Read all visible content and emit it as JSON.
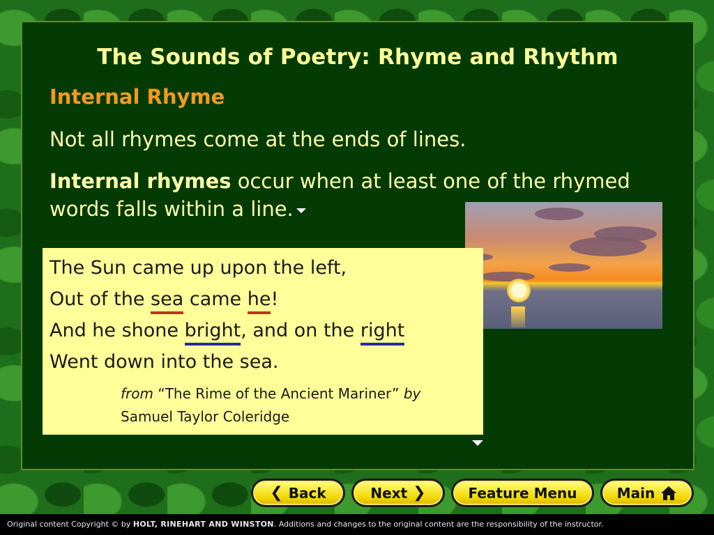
{
  "slide": {
    "title": "The Sounds of Poetry: Rhyme and Rhythm",
    "subtitle": "Internal Rhyme",
    "line1": "Not all rhymes come at the ends of lines.",
    "definition_term": "Internal rhymes",
    "definition_rest": " occur when at least one of the rhymed words falls within a line."
  },
  "poem": {
    "line1": "The Sun came up upon the left,",
    "line2_a": "Out of the ",
    "line2_b": "sea",
    "line2_c": " came ",
    "line2_d": "he",
    "line2_e": "!",
    "line3_a": "And he shone ",
    "line3_b": "bright",
    "line3_c": ", and on the ",
    "line3_d": "right",
    "line4": "Went down into the sea.",
    "cite_from": "from",
    "cite_title": " “The Rime of the Ancient Mariner” ",
    "cite_by": "by",
    "cite_author": "Samuel Taylor Coleridge"
  },
  "nav": {
    "back": "Back",
    "next": "Next",
    "feature_menu": "Feature Menu",
    "main": "Main"
  },
  "footer": {
    "prefix": "Original content Copyright © by ",
    "publisher": "HOLT, RINEHART AND WINSTON",
    "suffix": ". Additions and changes to the original content are the responsibility of the instructor."
  },
  "colors": {
    "slide_bg": "#043b05",
    "title": "#ffff99",
    "subtitle": "#f39a1f",
    "poem_bg": "#ffff99",
    "underline_red": "#b83a14",
    "underline_blue": "#2a2a9a"
  },
  "icons": [
    "chevron-left-icon",
    "chevron-right-icon",
    "home-icon",
    "down-arrow-icon"
  ]
}
